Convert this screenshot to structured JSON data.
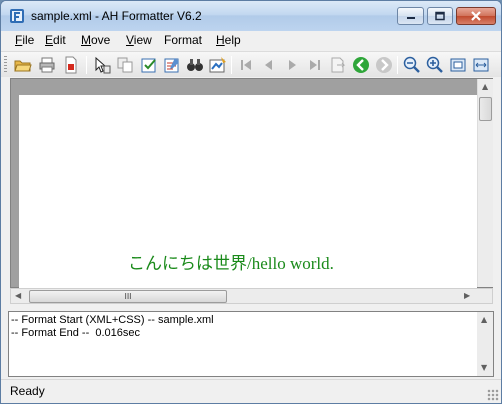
{
  "window": {
    "title": "sample.xml - AH Formatter V6.2",
    "caption_buttons": [
      "minimize-icon",
      "maximize-icon",
      "close-icon"
    ]
  },
  "menu": [
    {
      "accel": "F",
      "rest": "ile"
    },
    {
      "accel": "E",
      "rest": "dit"
    },
    {
      "accel": "M",
      "rest": "ove"
    },
    {
      "accel": "V",
      "rest": "iew"
    },
    {
      "accel": "",
      "rest": "Format"
    },
    {
      "accel": "H",
      "rest": "elp"
    }
  ],
  "toolbar": {
    "icons": [
      "open-folder-icon",
      "print-icon",
      "pdf-icon",
      "select-pointer-icon",
      "copy-icon",
      "edit-check-icon",
      "edit-list-icon",
      "find-binoculars-icon",
      "format-icon",
      "first-page-icon",
      "prev-page-icon",
      "next-page-icon",
      "last-page-icon",
      "goto-page-icon",
      "back-icon",
      "forward-icon",
      "zoom-out-icon",
      "zoom-in-icon",
      "fit-page-icon",
      "fit-width-icon"
    ]
  },
  "document": {
    "text": "こんにちは世界/hello world.",
    "text_color": "#1a8a1a"
  },
  "hscroll": {
    "thumb_label": "III"
  },
  "log": {
    "lines": [
      "-- Format Start (XML+CSS) -- sample.xml",
      "-- Format End --  0.016sec"
    ]
  },
  "statusbar": {
    "text": "Ready"
  }
}
